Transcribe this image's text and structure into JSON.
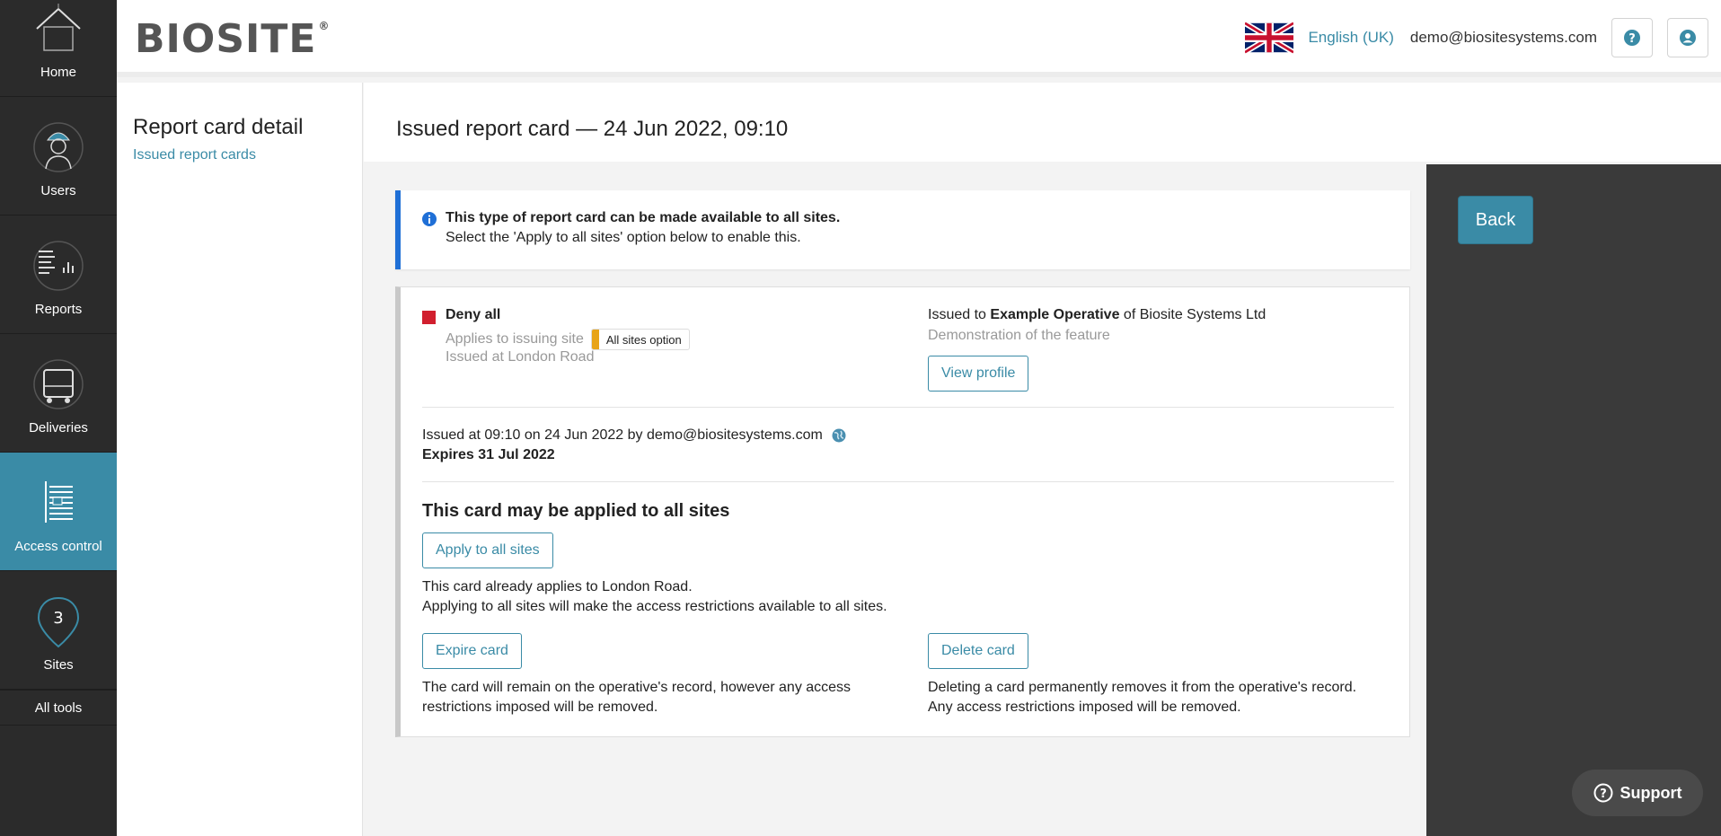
{
  "brand": {
    "logo": "BIOSITE",
    "reg": "®"
  },
  "nav": {
    "items": [
      {
        "label": "Home"
      },
      {
        "label": "Users"
      },
      {
        "label": "Reports"
      },
      {
        "label": "Deliveries"
      },
      {
        "label": "Access control"
      },
      {
        "label": "Sites"
      }
    ],
    "all_tools": "All tools"
  },
  "header": {
    "language": "English (UK)",
    "email": "demo@biositesystems.com"
  },
  "subnav": {
    "title": "Report card detail",
    "link": "Issued report cards"
  },
  "page": {
    "title": "Issued report card — 24 Jun 2022, 09:10"
  },
  "banner": {
    "line1": "This type of report card can be made available to all sites.",
    "line2": "Select the 'Apply to all sites' option below to enable this."
  },
  "card": {
    "type": "Deny all",
    "applies": "Applies to issuing site",
    "tag": "All sites option",
    "issued_at_site": "Issued at London Road",
    "issued_to_prefix": "Issued to",
    "issued_to_name": "Example Operative",
    "issued_to_suffix": "of Biosite Systems Ltd",
    "description": "Demonstration of the feature",
    "view_profile": "View profile",
    "issued_meta": "Issued at 09:10 on 24 Jun 2022 by demo@biositesystems.com",
    "expires": "Expires 31 Jul 2022",
    "all_sites_heading": "This card may be applied to all sites",
    "apply_button": "Apply to all sites",
    "apply_note1": "This card already applies to London Road.",
    "apply_note2": "Applying to all sites will make the access restrictions available to all sites.",
    "expire_button": "Expire card",
    "expire_note1": "The card will remain on the operative's record, however any access",
    "expire_note2": "restrictions imposed will be removed.",
    "delete_button": "Delete card",
    "delete_note1": "Deleting a card permanently removes it from the operative's record.",
    "delete_note2": "Any access restrictions imposed will be removed."
  },
  "actions": {
    "back": "Back",
    "support": "Support"
  },
  "colors": {
    "accent": "#3a8ba6",
    "nav_bg": "#2b2b2b",
    "deny": "#d11f2e",
    "info": "#1f6fd6",
    "tag": "#e8a418"
  }
}
